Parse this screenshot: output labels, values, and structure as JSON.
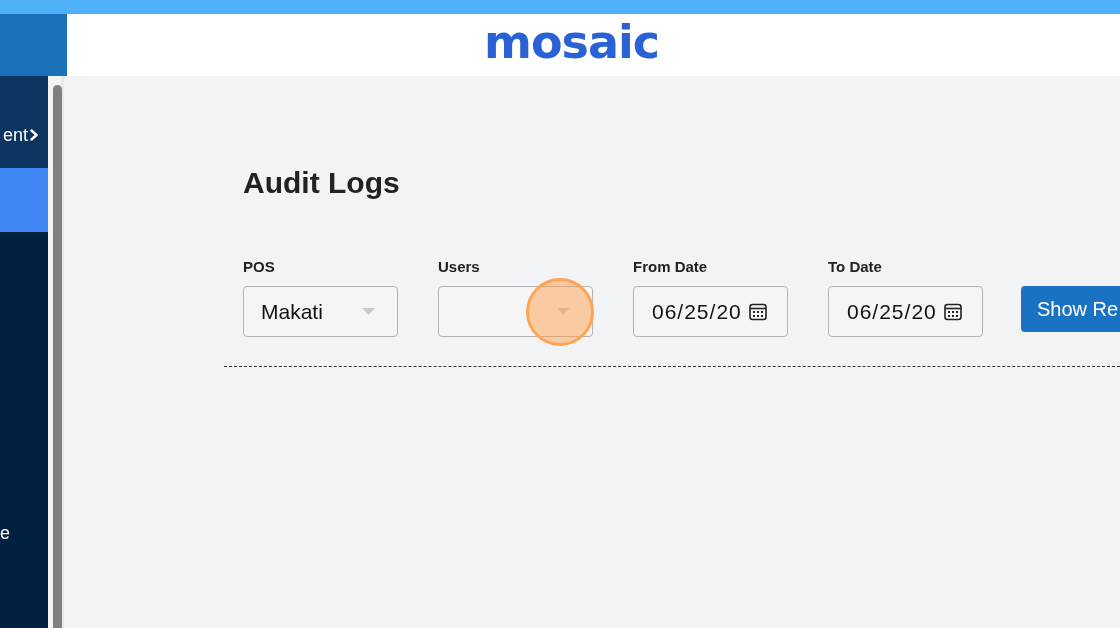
{
  "header": {
    "logo": "mosaic"
  },
  "sidebar": {
    "items": [
      {
        "label": "ent",
        "kind": "group",
        "selected": false
      },
      {
        "kind": "item",
        "selected": true
      },
      {
        "label": "e",
        "kind": "item",
        "selected": false
      }
    ]
  },
  "page": {
    "title": "Audit Logs",
    "filters": [
      {
        "label": "POS",
        "kind": "select",
        "value": "Makati",
        "highlighted": false
      },
      {
        "label": "Users",
        "kind": "select",
        "highlighted": true
      },
      {
        "label": "From Date",
        "kind": "date",
        "value": "06/25/20",
        "highlighted": false
      },
      {
        "label": "To Date",
        "kind": "date",
        "value": "06/25/20",
        "highlighted": false
      }
    ],
    "button": "Show Re"
  }
}
